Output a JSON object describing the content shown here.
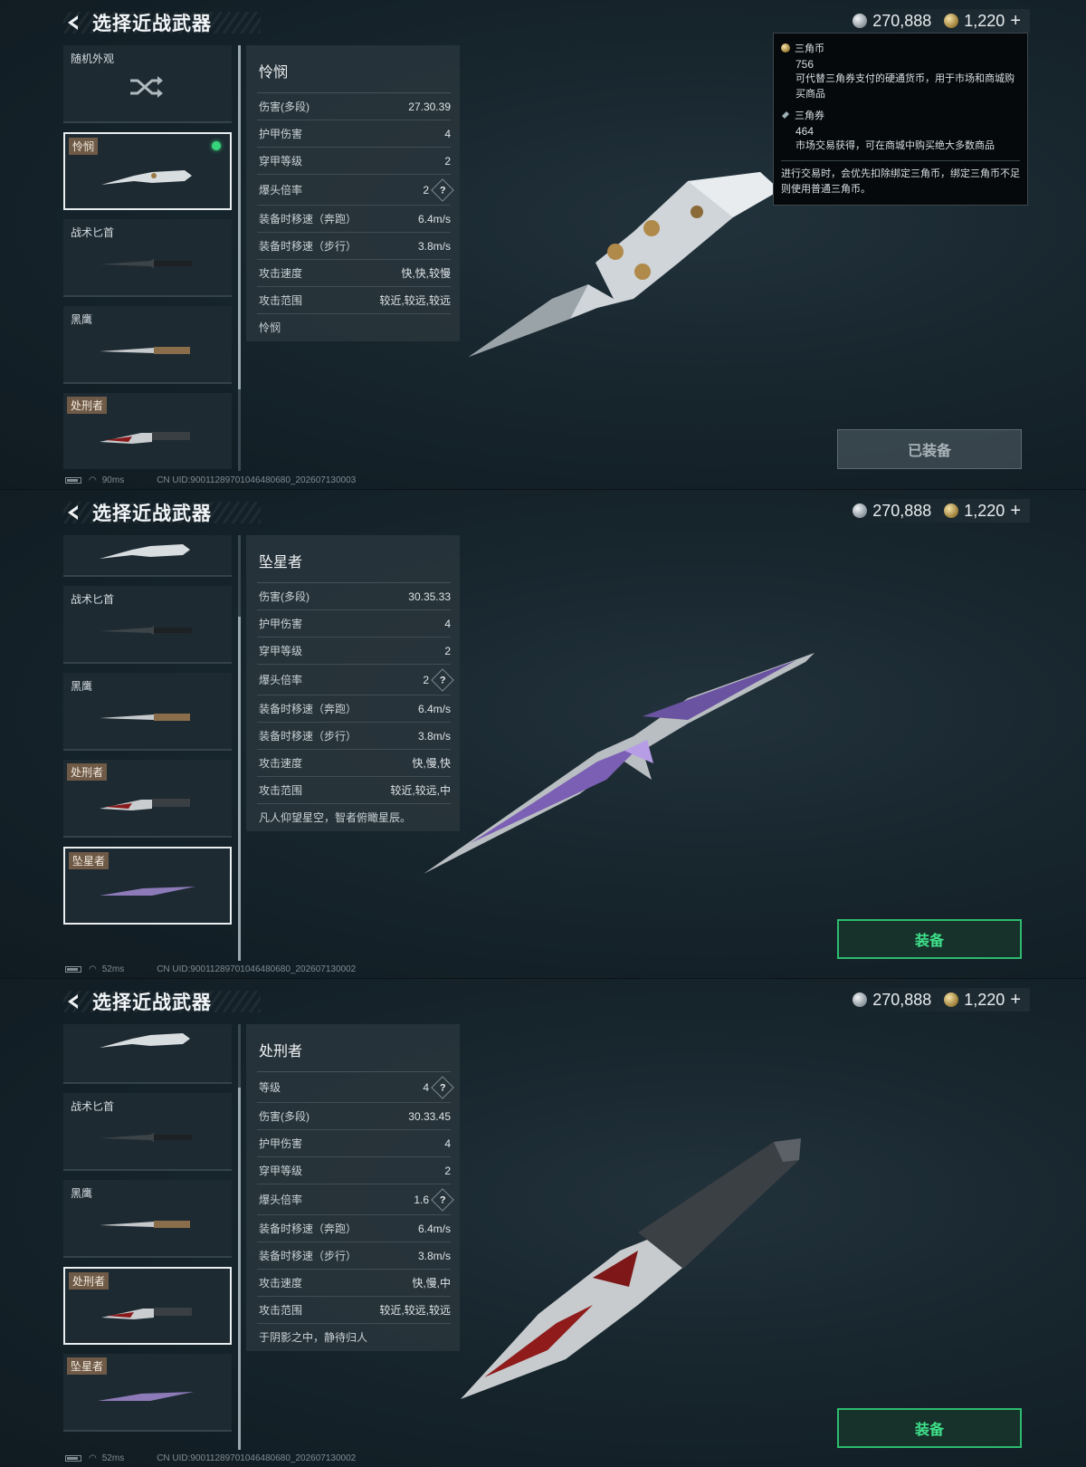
{
  "currency": {
    "silver": "270,888",
    "gold": "1,220",
    "plus": "+"
  },
  "header": {
    "title": "选择近战武器"
  },
  "tooltip": {
    "coin_name": "三角币",
    "coin_value": "756",
    "coin_desc": "可代替三角券支付的硬通货币，用于市场和商城购买商品",
    "ticket_name": "三角券",
    "ticket_value": "464",
    "ticket_desc": "市场交易获得，可在商城中购买绝大多数商品",
    "note": "进行交易时，会优先扣除绑定三角币，绑定三角币不足则使用普通三角币。"
  },
  "panels": [
    {
      "list": [
        "随机外观",
        "怜悯",
        "战术匕首",
        "黑鹰",
        "处刑者"
      ],
      "stats": {
        "name": "怜悯",
        "rows": [
          {
            "k": "伤害(多段)",
            "v": "27.30.39"
          },
          {
            "k": "护甲伤害",
            "v": "4"
          },
          {
            "k": "穿甲等级",
            "v": "2"
          },
          {
            "k": "爆头倍率",
            "v": "2"
          },
          {
            "k": "装备时移速（奔跑）",
            "v": "6.4m/s"
          },
          {
            "k": "装备时移速（步行）",
            "v": "3.8m/s"
          },
          {
            "k": "攻击速度",
            "v": "快,快,较慢"
          },
          {
            "k": "攻击范围",
            "v": "较近,较远,较远"
          }
        ],
        "desc": "怜悯"
      },
      "button": "已装备",
      "footer": {
        "ping": "90ms",
        "uid": "CN UID:9001128970104648068​0_202607130003"
      }
    },
    {
      "list": [
        "",
        "战术匕首",
        "黑鹰",
        "处刑者",
        "坠星者"
      ],
      "stats": {
        "name": "坠星者",
        "rows": [
          {
            "k": "伤害(多段)",
            "v": "30.35.33"
          },
          {
            "k": "护甲伤害",
            "v": "4"
          },
          {
            "k": "穿甲等级",
            "v": "2"
          },
          {
            "k": "爆头倍率",
            "v": "2"
          },
          {
            "k": "装备时移速（奔跑）",
            "v": "6.4m/s"
          },
          {
            "k": "装备时移速（步行）",
            "v": "3.8m/s"
          },
          {
            "k": "攻击速度",
            "v": "快,慢,快"
          },
          {
            "k": "攻击范围",
            "v": "较近,较远,中"
          }
        ],
        "desc": "凡人仰望星空，智者俯瞰星辰。"
      },
      "button": "装备",
      "footer": {
        "ping": "52ms",
        "uid": "CN UID:9001128970104648068​0_202607130002"
      }
    },
    {
      "list": [
        "",
        "战术匕首",
        "黑鹰",
        "处刑者",
        "坠星者"
      ],
      "stats": {
        "name": "处刑者",
        "level_label": "等级",
        "level_value": "4",
        "rows": [
          {
            "k": "伤害(多段)",
            "v": "30.33.45"
          },
          {
            "k": "护甲伤害",
            "v": "4"
          },
          {
            "k": "穿甲等级",
            "v": "2"
          },
          {
            "k": "爆头倍率",
            "v": "1.6"
          },
          {
            "k": "装备时移速（奔跑）",
            "v": "6.4m/s"
          },
          {
            "k": "装备时移速（步行）",
            "v": "3.8m/s"
          },
          {
            "k": "攻击速度",
            "v": "快,慢,中"
          },
          {
            "k": "攻击范围",
            "v": "较近,较远,较远"
          }
        ],
        "desc": "于阴影之中，静待归人"
      },
      "button": "装备",
      "footer": {
        "ping": "52ms",
        "uid": "CN UID:9001128970104648068​0_202607130002"
      }
    }
  ]
}
